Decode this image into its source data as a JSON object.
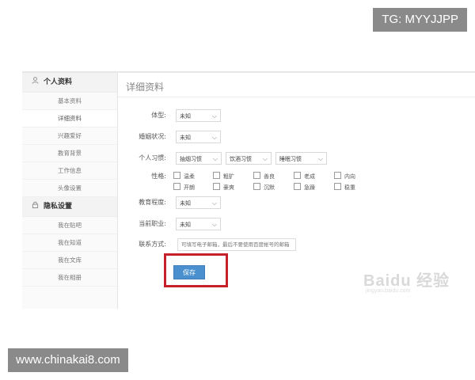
{
  "overlay": {
    "tg_label": "TG: MYYJJPP",
    "site_label": "www.chinakai8.com"
  },
  "sidebar": {
    "personal_header": "个人资料",
    "personal_items": [
      "基本资料",
      "详细资料",
      "兴趣爱好",
      "教育背景",
      "工作信息",
      "头像设置"
    ],
    "privacy_header": "隐私设置",
    "privacy_items": [
      "我在贴吧",
      "我在知道",
      "我在文库",
      "我在相册"
    ],
    "active_item": "详细资料"
  },
  "main": {
    "title": "详细资料",
    "body_type": {
      "label": "体型:",
      "value": "未知"
    },
    "marital": {
      "label": "婚姻状况:",
      "value": "未知"
    },
    "habits": {
      "label": "个人习惯:",
      "values": [
        "抽烟习惯",
        "饮酒习惯",
        "睡眠习惯"
      ]
    },
    "personality": {
      "label": "性格:",
      "options": [
        "温柔",
        "粗犷",
        "善良",
        "老成",
        "内向",
        "开朗",
        "豪爽",
        "沉默",
        "急躁",
        "稳重"
      ]
    },
    "education": {
      "label": "教育程度:",
      "value": "未知"
    },
    "occupation": {
      "label": "当前职业:",
      "value": "未知"
    },
    "contact": {
      "label": "联系方式:",
      "placeholder": "可填写电子邮箱，最后不要使用百度帐号的邮箱"
    },
    "save_label": "保存"
  },
  "watermark": {
    "brand": "Baidu 经验",
    "url": "jingyan.baidu.com"
  },
  "icons": {
    "personal": "user-icon",
    "privacy": "lock-icon",
    "dropdown": "chevron-down-icon"
  },
  "colors": {
    "highlight": "#c6212a",
    "button": "#4a90cf"
  }
}
